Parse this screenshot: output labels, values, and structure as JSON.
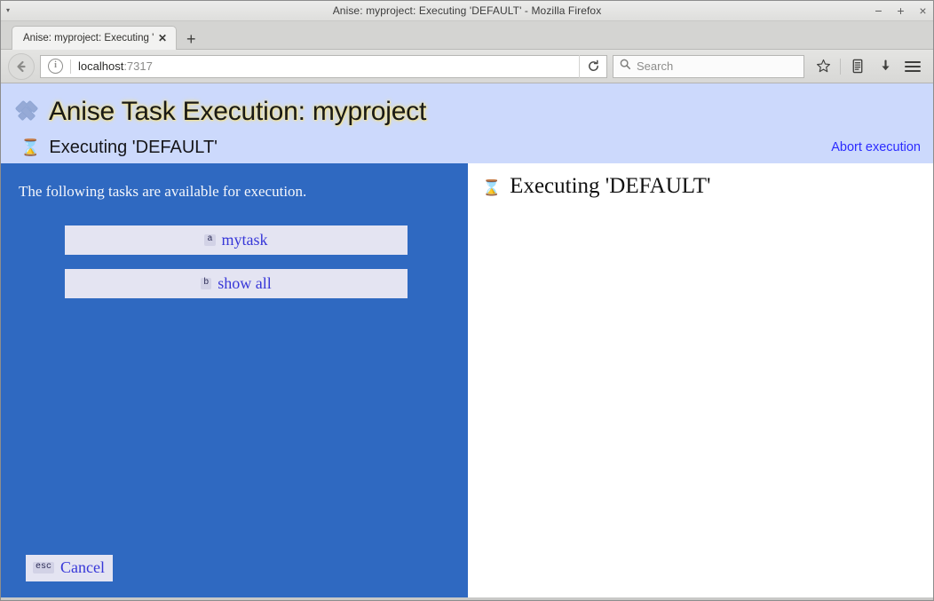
{
  "window": {
    "title": "Anise: myproject: Executing 'DEFAULT' - Mozilla Firefox",
    "menu_arrow": "▾",
    "minimize": "−",
    "maximize": "+",
    "close": "×"
  },
  "browser": {
    "tab": {
      "label": "Anise: myproject: Executing '...",
      "close": "✕"
    },
    "new_tab": "+",
    "back_icon": "←",
    "info_icon": "i",
    "url": {
      "host": "localhost",
      "port": ":7317"
    },
    "reload_icon": "⟳",
    "search": {
      "placeholder": "Search",
      "icon": "search-icon"
    },
    "icons": {
      "bookmark": "☆",
      "library": "library-icon",
      "downloads": "⬇",
      "menu": "menu-icon"
    }
  },
  "page": {
    "header": {
      "icon": "crossed-hammers-icon",
      "title": "Anise Task Execution: myproject",
      "status_icon": "⌛",
      "status_text": "Executing 'DEFAULT'",
      "abort_label": "Abort execution",
      "bg_color": "#ccd9fc",
      "link_color": "#2b2bff"
    },
    "left_pane": {
      "bg_color": "#2f69c1",
      "intro": "The following tasks are available for execution.",
      "choices": [
        {
          "key": "a",
          "label": "mytask"
        },
        {
          "key": "b",
          "label": "show all"
        }
      ],
      "cancel": {
        "key": "esc",
        "label": "Cancel"
      }
    },
    "right_pane": {
      "status_icon": "⌛",
      "status_text": "Executing 'DEFAULT'"
    }
  }
}
